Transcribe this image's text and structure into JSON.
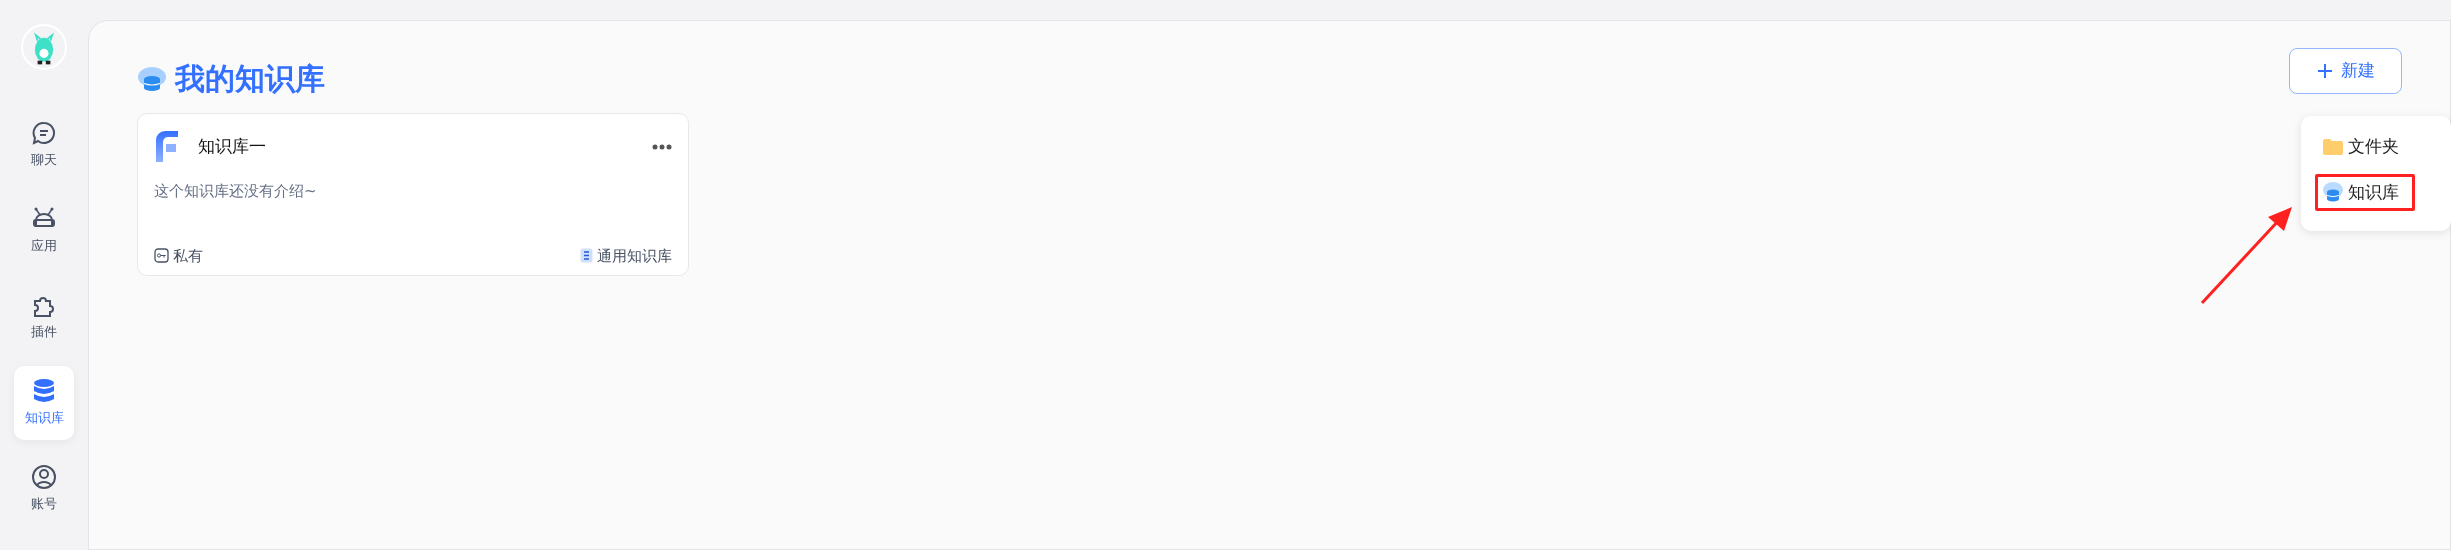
{
  "sidebar": {
    "items": [
      {
        "label": "聊天",
        "selected": false
      },
      {
        "label": "应用",
        "selected": false
      },
      {
        "label": "插件",
        "selected": false
      },
      {
        "label": "知识库",
        "selected": true
      },
      {
        "label": "账号",
        "selected": false
      }
    ]
  },
  "page": {
    "title": "我的知识库",
    "new_button": "新建"
  },
  "cards": [
    {
      "title": "知识库一",
      "description": "这个知识库还没有介绍~",
      "visibility": "私有",
      "type": "通用知识库"
    }
  ],
  "dropdown": {
    "items": [
      {
        "label": "文件夹",
        "highlighted": false
      },
      {
        "label": "知识库",
        "highlighted": true
      }
    ]
  }
}
